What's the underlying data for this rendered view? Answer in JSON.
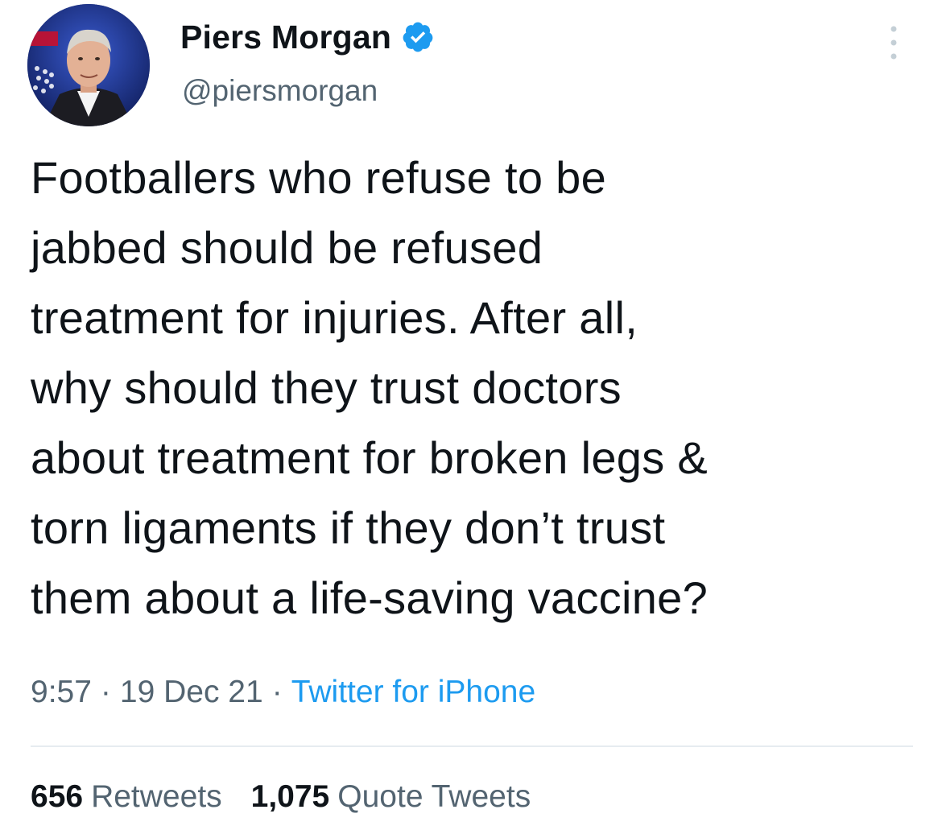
{
  "author": {
    "display_name": "Piers Morgan",
    "handle": "@piersmorgan",
    "verified": true,
    "avatar_icon": "profile-photo"
  },
  "tweet": {
    "text_lines": [
      "Footballers who refuse to be",
      "jabbed should be refused",
      "treatment for injuries. After all,",
      "why should they trust doctors",
      "about treatment for broken legs &",
      "torn ligaments if they don’t trust",
      "them about a life-saving vaccine?"
    ],
    "time": "9:57",
    "date": "19 Dec 21",
    "separator": "·",
    "source": "Twitter for iPhone"
  },
  "stats": {
    "retweets_count": "656",
    "retweets_label": "Retweets",
    "quotes_count": "1,075",
    "quotes_label": "Quote Tweets"
  },
  "colors": {
    "text": "#0f1419",
    "muted": "#536471",
    "accent": "#1d9bf0",
    "divider": "#e6ecf0"
  }
}
